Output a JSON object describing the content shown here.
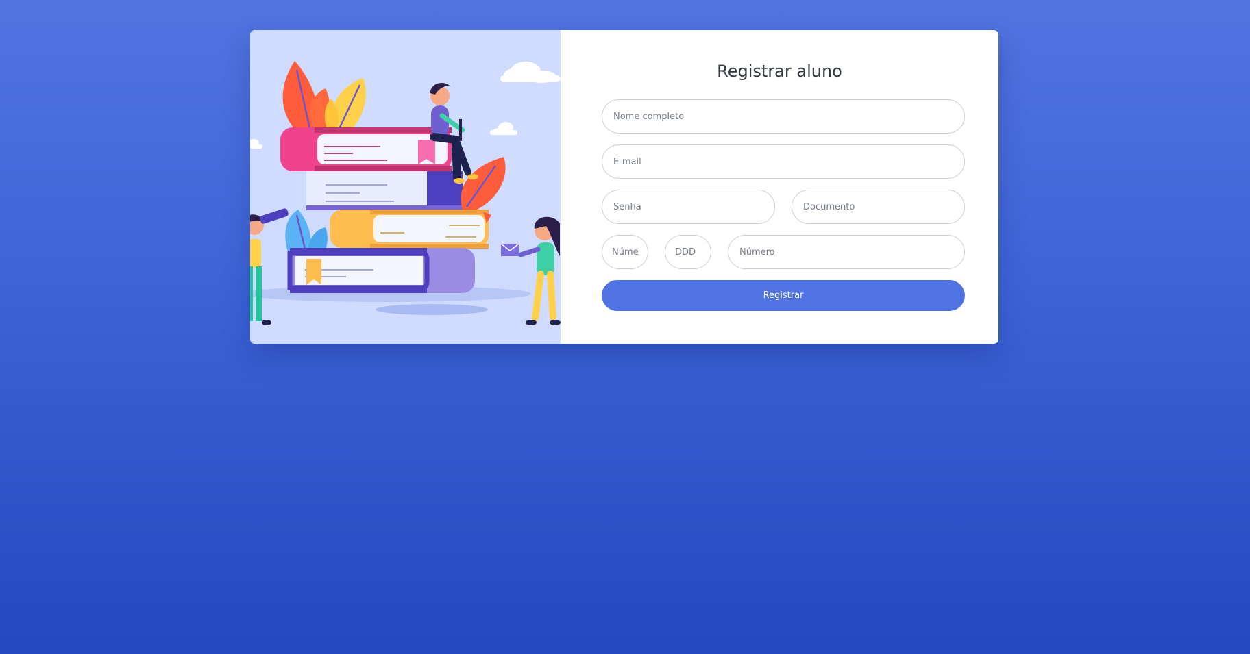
{
  "form": {
    "title": "Registrar aluno",
    "fields": {
      "full_name_placeholder": "Nome completo",
      "email_placeholder": "E-mail",
      "password_placeholder": "Senha",
      "document_placeholder": "Documento",
      "country_code_placeholder": "Núme",
      "ddd_placeholder": "DDD",
      "number_placeholder": "Número"
    },
    "submit_label": "Registrar"
  },
  "colors": {
    "background_top": "#5174e1",
    "background_bottom": "#2448be",
    "illustration_bg": "#d0dcff",
    "primary_button": "#4f73e3"
  }
}
